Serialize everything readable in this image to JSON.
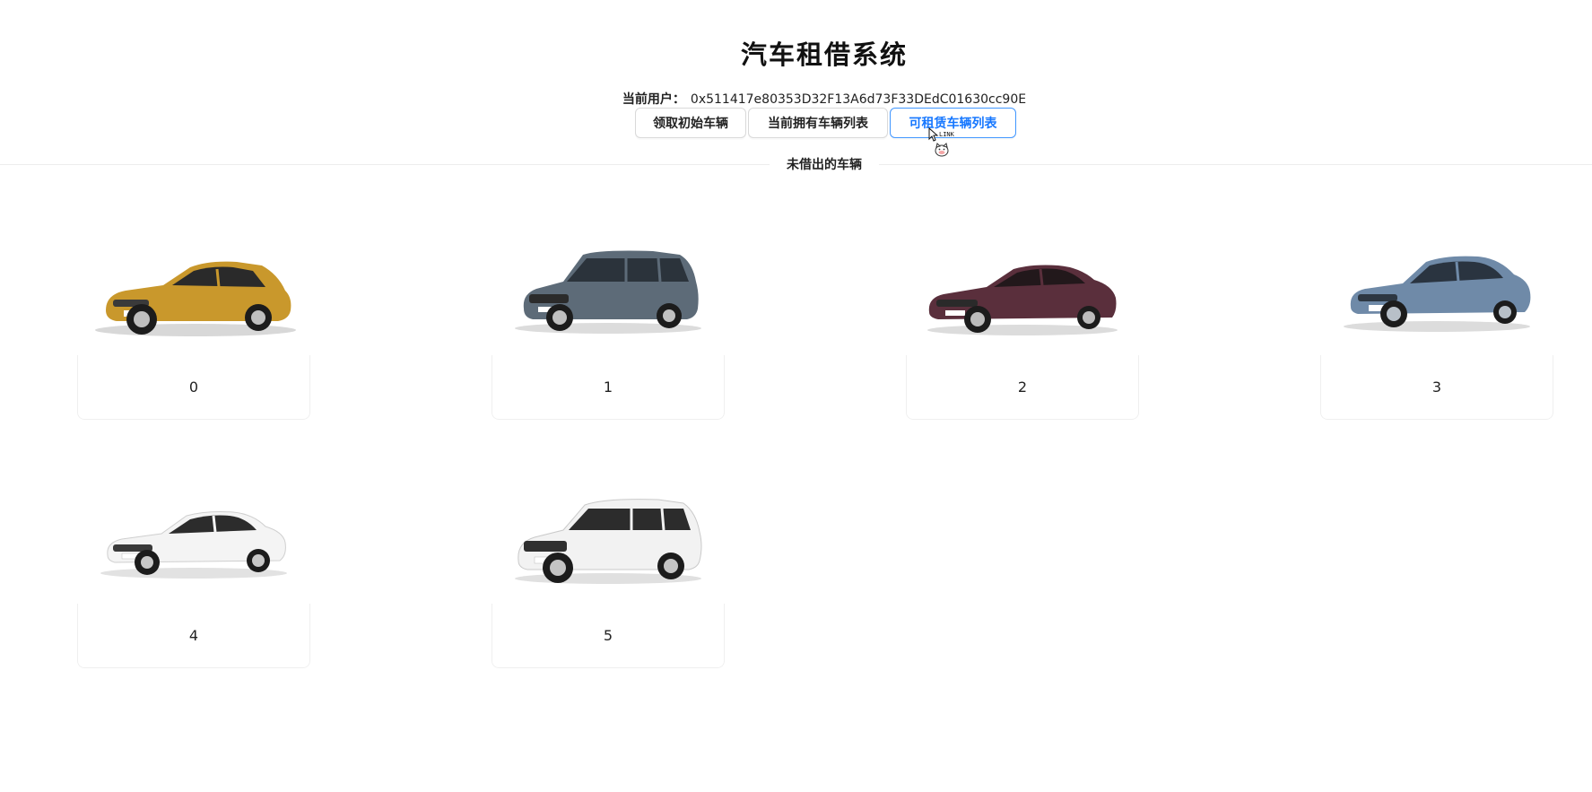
{
  "header": {
    "title": "汽车租借系统",
    "user_label": "当前用户：",
    "user_address": "0x511417e80353D32F13A6d73F33DEdC01630cc90E"
  },
  "toolbar": {
    "buttons": [
      {
        "label": "领取初始车辆",
        "active": false
      },
      {
        "label": "当前拥有车辆列表",
        "active": false
      },
      {
        "label": "可租赁车辆列表",
        "active": true
      }
    ]
  },
  "cursor_tooltip": "LINK",
  "section": {
    "title": "未借出的车辆"
  },
  "cars": [
    {
      "id": "0",
      "color": "#c9982c",
      "style": "hatchback-icon"
    },
    {
      "id": "1",
      "color": "#5d6b78",
      "style": "mpv-icon"
    },
    {
      "id": "2",
      "color": "#5a2f3c",
      "style": "sedan-icon"
    },
    {
      "id": "3",
      "color": "#6f8aa8",
      "style": "sedan-icon"
    },
    {
      "id": "4",
      "color": "#f2f2f2",
      "style": "sedan-icon"
    },
    {
      "id": "5",
      "color": "#eeeeee",
      "style": "suv-icon"
    }
  ],
  "colors": {
    "accent": "#1677ff",
    "border": "#d9d9d9"
  }
}
